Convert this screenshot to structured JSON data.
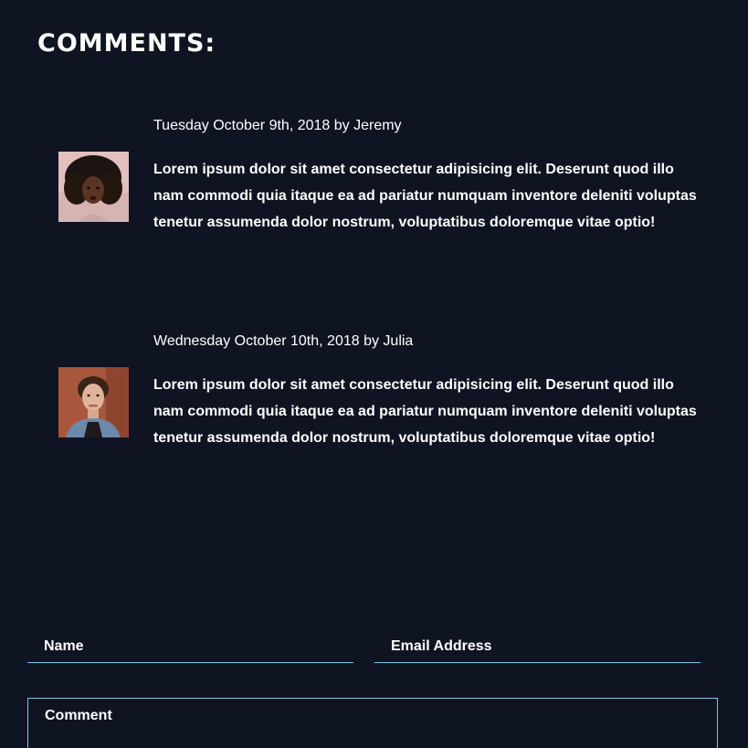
{
  "page": {
    "section_title": "COMMENTS:"
  },
  "comments": [
    {
      "meta": "Tuesday October 9th, 2018 by Jeremy",
      "avatar_icon": "person-photo-curly-hair",
      "body": "Lorem ipsum dolor sit amet consectetur adipisicing elit. Deserunt quod illo nam commodi quia itaque ea ad pariatur numquam inventore deleniti voluptas tenetur assumenda dolor nostrum, voluptatibus doloremque vitae optio!"
    },
    {
      "meta": "Wednesday October 10th, 2018 by Julia",
      "avatar_icon": "person-photo-short-hair",
      "body": "Lorem ipsum dolor sit amet consectetur adipisicing elit. Deserunt quod illo nam commodi quia itaque ea ad pariatur numquam inventore deleniti voluptas tenetur assumenda dolor nostrum, voluptatibus doloremque vitae optio!"
    }
  ],
  "form": {
    "name_placeholder": "Name",
    "name_value": "",
    "email_placeholder": "Email Address",
    "email_value": "",
    "comment_placeholder": "Comment",
    "comment_value": ""
  },
  "colors": {
    "background": "#0f1422",
    "text": "#ffffff",
    "input_border": "#7fc6e6"
  }
}
